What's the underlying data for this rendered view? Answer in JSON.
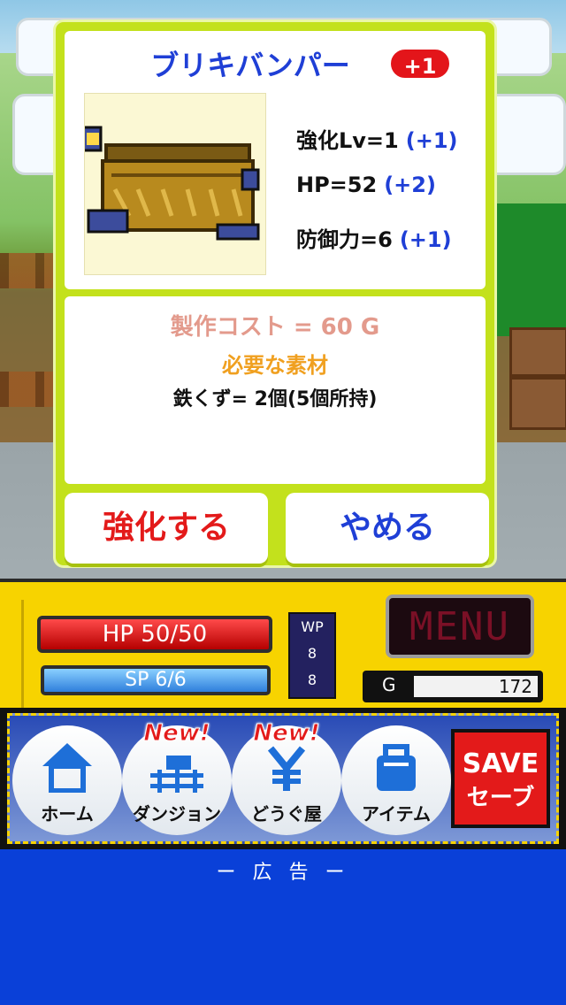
{
  "popup": {
    "item_name": "ブリキバンパー",
    "plus_badge": "+1",
    "stats": [
      {
        "label": "強化Lv=1",
        "plus": "(+1)"
      },
      {
        "label": "HP=52",
        "plus": "(+2)"
      },
      {
        "label": "防御力=6",
        "plus": "(+1)"
      }
    ],
    "cost_text": "製作コスト = 60 G",
    "materials_header": "必要な素材",
    "materials_line": "鉄くず= 2個(5個所持)",
    "upgrade_label": "強化する",
    "cancel_label": "やめる"
  },
  "hud": {
    "hp_text": "HP 50/50",
    "sp_text": "SP 6/6",
    "wp_label": "WP",
    "wp_values": [
      "8",
      "8"
    ],
    "menu_label": "MENU",
    "gold_label": "G",
    "gold_value": "172"
  },
  "nav": {
    "items": [
      {
        "label": "ホーム",
        "icon": "home-icon",
        "new": ""
      },
      {
        "label": "ダンジョン",
        "icon": "train-track-icon",
        "new": "New!"
      },
      {
        "label": "どうぐ屋",
        "icon": "yen-icon",
        "new": "New!"
      },
      {
        "label": "アイテム",
        "icon": "bag-icon",
        "new": ""
      }
    ],
    "save_line1": "SAVE",
    "save_line2": "セーブ"
  },
  "ad": {
    "label": "ー 広 告 ー"
  },
  "colors": {
    "popup_frame": "#c3e11c",
    "title_blue": "#1f3fd6",
    "accent_red": "#e31a1a",
    "hud_yellow": "#f7d300",
    "ad_blue": "#0a40d8"
  }
}
